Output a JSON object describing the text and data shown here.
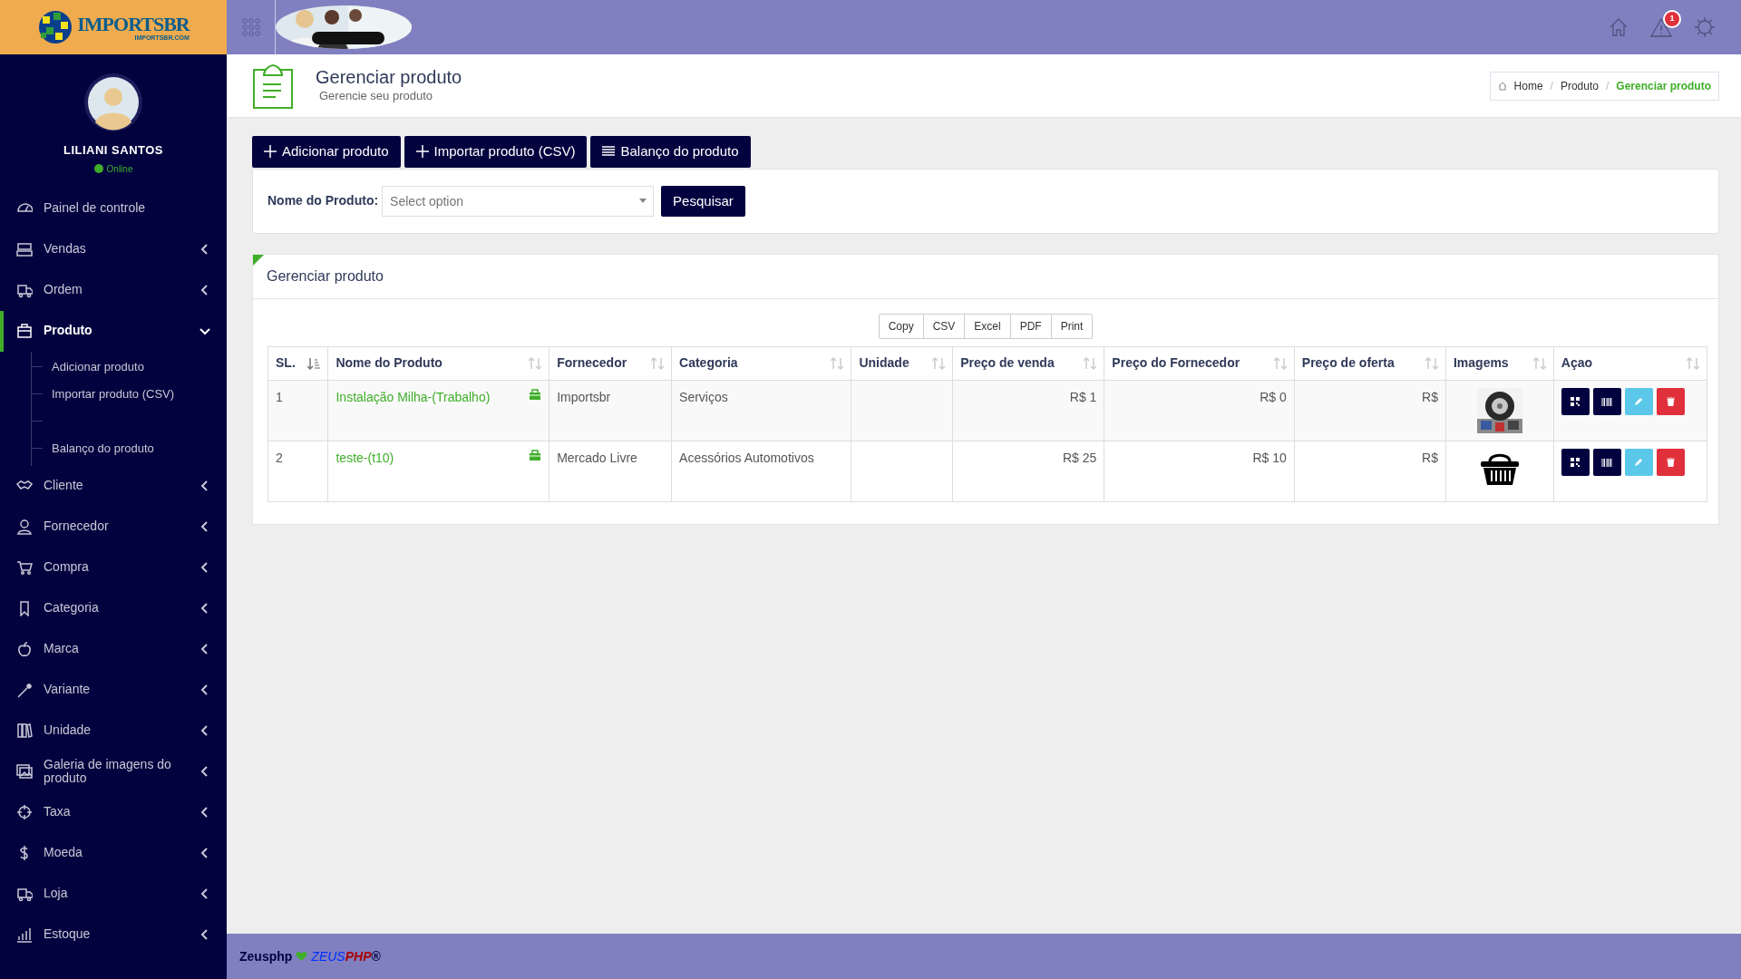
{
  "brand": {
    "name": "IMPORTSBR",
    "domain": "IMPORTSBR.COM"
  },
  "user": {
    "name": "LILIANI SANTOS",
    "status": "Online"
  },
  "sidebar": {
    "items": [
      {
        "kind": "link",
        "label": "Painel de controle",
        "selected": false
      },
      {
        "kind": "menu",
        "label": "Vendas",
        "expanded": false,
        "selected": false
      },
      {
        "kind": "menu",
        "label": "Ordem",
        "expanded": false,
        "selected": false
      },
      {
        "kind": "menu",
        "label": "Produto",
        "expanded": true,
        "selected": true,
        "children": [
          {
            "kind": "link",
            "label": "Adicionar produto"
          },
          {
            "kind": "link",
            "label": "Importar produto (CSV)"
          },
          {
            "kind": "blank"
          },
          {
            "kind": "link",
            "label": "Balanço do produto"
          }
        ]
      },
      {
        "kind": "menu",
        "label": "Cliente",
        "expanded": false,
        "selected": false
      },
      {
        "kind": "menu",
        "label": "Fornecedor",
        "expanded": false,
        "selected": false
      },
      {
        "kind": "menu",
        "label": "Compra",
        "expanded": false,
        "selected": false
      },
      {
        "kind": "menu",
        "label": "Categoria",
        "expanded": false,
        "selected": false
      },
      {
        "kind": "menu",
        "label": "Marca",
        "expanded": false,
        "selected": false
      },
      {
        "kind": "menu",
        "label": "Variante",
        "expanded": false,
        "selected": false
      },
      {
        "kind": "menu",
        "label": "Unidade",
        "expanded": false,
        "selected": false
      },
      {
        "kind": "menu",
        "label": "Galeria de imagens do produto",
        "expanded": false,
        "selected": false
      },
      {
        "kind": "menu",
        "label": "Taxa",
        "expanded": false,
        "selected": false
      },
      {
        "kind": "menu",
        "label": "Moeda",
        "expanded": false,
        "selected": false
      },
      {
        "kind": "menu",
        "label": "Loja",
        "expanded": false,
        "selected": false
      },
      {
        "kind": "menu",
        "label": "Estoque",
        "expanded": false,
        "selected": false
      }
    ]
  },
  "topbar": {
    "alert_count": "1"
  },
  "page_header": {
    "title": "Gerenciar produto",
    "subtitle": "Gerencie seu produto"
  },
  "breadcrumb": [
    {
      "label": "Home",
      "selected": false
    },
    {
      "separator": "/",
      "label": "Produto",
      "selected": false
    },
    {
      "separator": "/",
      "label": "Gerenciar produto",
      "selected": true
    }
  ],
  "actions": [
    {
      "kind": "add",
      "label": "Adicionar produto"
    },
    {
      "kind": "add",
      "label": "Importar produto (CSV)"
    },
    {
      "kind": "list",
      "label": "Balanço do produto"
    }
  ],
  "search": {
    "label": "Nome do Produto:",
    "placeholder": "Select option",
    "button": "Pesquisar"
  },
  "panel": {
    "title": "Gerenciar produto"
  },
  "export_buttons": [
    "Copy",
    "CSV",
    "Excel",
    "PDF",
    "Print"
  ],
  "table": {
    "columns": [
      {
        "label": "SL.",
        "sorted": true
      },
      {
        "label": "Nome do Produto",
        "sorted": false
      },
      {
        "label": "Fornecedor",
        "sorted": false
      },
      {
        "label": "Categoria",
        "sorted": false
      },
      {
        "label": "Unidade",
        "sorted": false
      },
      {
        "label": "Preço de venda",
        "sorted": false
      },
      {
        "label": "Preço do Fornecedor",
        "sorted": false
      },
      {
        "label": "Preço de oferta",
        "sorted": false
      },
      {
        "label": "Imagems",
        "sorted": false
      },
      {
        "label": "Açao",
        "sorted": false
      }
    ],
    "rows": [
      {
        "sl": "1",
        "name": "Instalação Milha-(Trabalho)",
        "supplier": "Importsbr",
        "category": "Serviços",
        "sale_price": "R$ 1",
        "supplier_price": "R$ 0",
        "offer_price": "R$"
      },
      {
        "sl": "2",
        "name": "teste-(t10)",
        "supplier": "Mercado Livre",
        "category": "Acessórios Automotivos",
        "sale_price": "R$ 25",
        "supplier_price": "R$ 10",
        "offer_price": "R$",
        "image": {
          "kind": "basket"
        }
      }
    ]
  },
  "footer": {
    "text": "Zeusphp",
    "brand_first": "ZEUS",
    "brand_second": "PHP",
    "mark": "®"
  }
}
